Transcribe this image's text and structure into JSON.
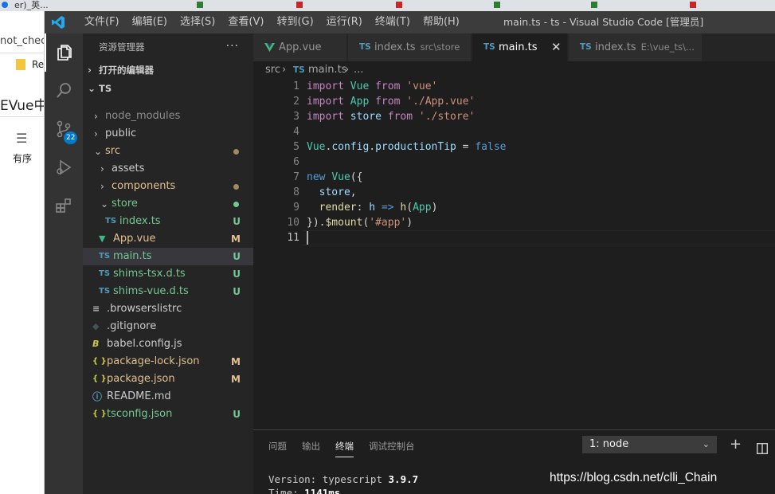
{
  "background_browser": {
    "tabs": [
      "er)_英..."
    ],
    "rows": [
      "not_chec",
      "Re",
      "EVue中",
      "有序"
    ]
  },
  "titlebar": {
    "menu": [
      "文件(F)",
      "编辑(E)",
      "选择(S)",
      "查看(V)",
      "转到(G)",
      "运行(R)",
      "终端(T)",
      "帮助(H)"
    ],
    "window_title": "main.ts - ts - Visual Studio Code [管理员]"
  },
  "activitybar": {
    "items": [
      "explorer-icon",
      "search-icon",
      "source-control-icon",
      "run-debug-icon",
      "extensions-icon"
    ],
    "scm_badge": "22"
  },
  "sidebar": {
    "title": "资源管理器",
    "more": "···",
    "open_editors": "打开的编辑器",
    "project": "TS",
    "tree": [
      {
        "label": "node_modules",
        "type": "folder",
        "state": "collapsed",
        "color": "dim",
        "status": ""
      },
      {
        "label": "public",
        "type": "folder",
        "state": "collapsed",
        "color": "norm",
        "status": ""
      },
      {
        "label": "src",
        "type": "folder",
        "state": "expanded",
        "color": "mod",
        "status": "dot-mod"
      },
      {
        "label": "assets",
        "type": "folder",
        "state": "collapsed",
        "color": "norm",
        "status": ""
      },
      {
        "label": "components",
        "type": "folder",
        "state": "collapsed",
        "color": "mod",
        "status": "dot-mod"
      },
      {
        "label": "store",
        "type": "folder",
        "state": "expanded",
        "color": "new",
        "status": "dot-new"
      },
      {
        "label": "index.ts",
        "type": "ts",
        "color": "new",
        "status": "U"
      },
      {
        "label": "App.vue",
        "type": "vue",
        "color": "mod",
        "status": "M"
      },
      {
        "label": "main.ts",
        "type": "ts",
        "color": "new",
        "status": "U"
      },
      {
        "label": "shims-tsx.d.ts",
        "type": "ts",
        "color": "new",
        "status": "U"
      },
      {
        "label": "shims-vue.d.ts",
        "type": "ts",
        "color": "new",
        "status": "U"
      },
      {
        "label": ".browserslistrc",
        "type": "lines",
        "color": "norm",
        "status": ""
      },
      {
        "label": ".gitignore",
        "type": "git",
        "color": "norm",
        "status": ""
      },
      {
        "label": "babel.config.js",
        "type": "babel",
        "color": "norm",
        "status": ""
      },
      {
        "label": "package-lock.json",
        "type": "json",
        "color": "mod",
        "status": "M"
      },
      {
        "label": "package.json",
        "type": "json",
        "color": "mod",
        "status": "M"
      },
      {
        "label": "README.md",
        "type": "info",
        "color": "norm",
        "status": ""
      },
      {
        "label": "tsconfig.json",
        "type": "json",
        "color": "new",
        "status": "U"
      }
    ]
  },
  "tabs": [
    {
      "label": "App.vue",
      "sub": "",
      "icon": "vue"
    },
    {
      "label": "index.ts",
      "sub": "src\\store",
      "icon": "ts"
    },
    {
      "label": "main.ts",
      "sub": "",
      "icon": "ts",
      "active": true
    },
    {
      "label": "index.ts",
      "sub": "E:\\vue_ts\\...",
      "icon": "ts"
    }
  ],
  "breadcrumb": {
    "folder": "src",
    "file": "main.ts",
    "rest": "..."
  },
  "editor": {
    "line_numbers": [
      "1",
      "2",
      "3",
      "4",
      "5",
      "6",
      "7",
      "8",
      "9",
      "10",
      "11"
    ],
    "cursor_line": "11"
  },
  "panel": {
    "tabs": [
      "问题",
      "输出",
      "终端",
      "调试控制台"
    ],
    "active_tab": "终端",
    "terminal_select": "1: node",
    "lines": [
      {
        "label": "Version: typescript ",
        "value": "3.9.7"
      },
      {
        "label": "Time: ",
        "value": "1141ms"
      }
    ]
  },
  "watermark": "https://blog.csdn.net/clli_Chain",
  "colors": {
    "accent": "#007acc",
    "modified": "#e2c08d",
    "untracked": "#73c991",
    "ts": "#519aba",
    "vue": "#41b883"
  }
}
